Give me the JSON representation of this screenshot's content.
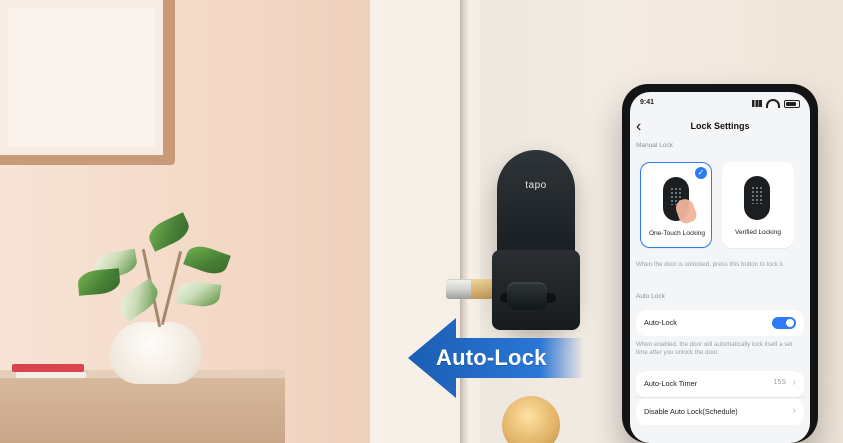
{
  "scene": {
    "product_logo": "tapo",
    "overlay_text": "Auto-Lock"
  },
  "phone": {
    "status_time": "9:41",
    "header_title": "Lock Settings",
    "manual_lock_label": "Manual Lock",
    "options": [
      {
        "label": "One-Touch Locking",
        "selected": true
      },
      {
        "label": "Verified Locking",
        "selected": false
      }
    ],
    "manual_help": "When the door is unlocked, press this button to lock it.",
    "auto_lock_label": "Auto Lock",
    "auto_lock_row_label": "Auto-Lock",
    "auto_lock_enabled": true,
    "auto_help": "When enabled, the door will automatically lock itself a set time after you unlock the door.",
    "timer_label": "Auto-Lock Timer",
    "timer_value": "15S",
    "schedule_label": "Disable Auto Lock(Schedule)"
  },
  "colors": {
    "accent": "#2d7cf6",
    "arrow_blue": "#1b5eb3"
  }
}
